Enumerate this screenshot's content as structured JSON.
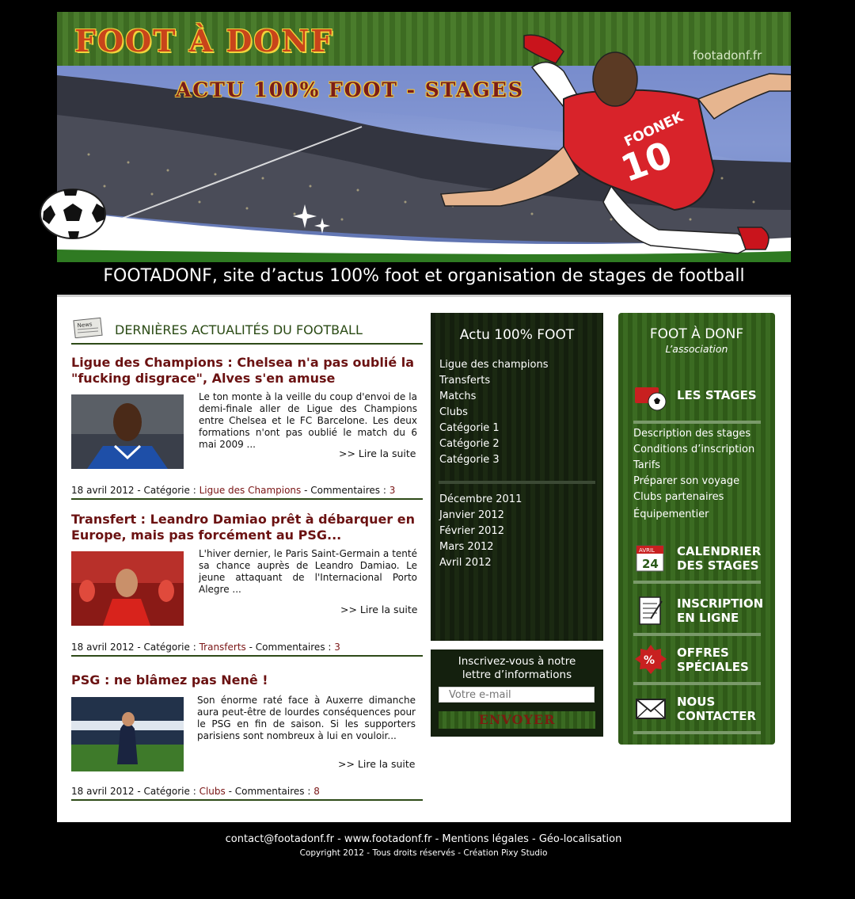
{
  "header": {
    "brand": "FOOT À DONF",
    "url": "footadonf.fr",
    "subtitle": "ACTU 100% FOOT - STAGES",
    "jersey_text": "FOONEK",
    "jersey_number": "10",
    "tagline": "FOOTADONF, site d’actus 100% foot et organisation de stages de football"
  },
  "news": {
    "section_title": "DERNIÈRES ACTUALITÉS DU FOOTBALL",
    "icon_text": "News",
    "articles": [
      {
        "title": "Ligue des Champions : Chelsea n'a pas oublié la \"fucking disgrace\", Alves s'en amuse",
        "text": "Le ton monte à la veille du coup d'envoi de la demi-finale aller de Ligue des Champions entre Chelsea et le FC Barcelone. Les deux formations n'ont pas oublié le match du 6 mai 2009 ...",
        "read_more": ">> Lire la suite",
        "date": "18 avril 2012",
        "category_label": "Catégorie :",
        "category": "Ligue des Champions",
        "comments_label": "Commentaires :",
        "comments": "3"
      },
      {
        "title": "Transfert : Leandro Damiao prêt à débarquer en Europe, mais pas forcément au PSG...",
        "text": "L'hiver dernier, le Paris Saint-Germain a tenté sa chance auprès de Leandro Damiao. Le jeune attaquant de l'Internacional Porto Alegre ...",
        "read_more": ">> Lire la suite",
        "date": "18 avril 2012",
        "category_label": "Catégorie :",
        "category": "Transferts",
        "comments_label": "Commentaires :",
        "comments": "3"
      },
      {
        "title": "PSG : ne blâmez pas Nenê !",
        "text": "Son énorme raté face à Auxerre dimanche aura peut-être de lourdes conséquences pour le PSG en fin de saison. Si les supporters parisiens sont nombreux à lui en vouloir...",
        "read_more": ">> Lire la suite",
        "date": "18 avril 2012",
        "category_label": "Catégorie :",
        "category": "Clubs",
        "comments_label": "Commentaires :",
        "comments": "8"
      }
    ]
  },
  "actu": {
    "title": "Actu 100% FOOT",
    "categories": [
      "Ligue des champions",
      "Transferts",
      "Matchs",
      "Clubs",
      "Catégorie 1",
      "Catégorie 2",
      "Catégorie 3"
    ],
    "archives": [
      "Décembre 2011",
      "Janvier 2012",
      "Février 2012",
      "Mars 2012",
      "Avril 2012"
    ]
  },
  "newsletter": {
    "label_line1": "Inscrivez-vous à notre",
    "label_line2": "lettre d’informations",
    "placeholder": "Votre e-mail",
    "button": "ENVOYER"
  },
  "association": {
    "title": "FOOT À DONF",
    "subtitle": "L’association",
    "stages_label": "LES STAGES",
    "stage_links": [
      "Description des stages",
      "Conditions d’inscription",
      "Tarifs",
      "Préparer son voyage",
      "Clubs partenaires",
      "Équipementier"
    ],
    "calendar_label_1": "CALENDRIER",
    "calendar_label_2": "DES STAGES",
    "calendar_month": "AVRIL",
    "calendar_day": "24",
    "inscription_label_1": "INSCRIPTION",
    "inscription_label_2": "EN LIGNE",
    "offers_label_1": "OFFRES",
    "offers_label_2": "SPÉCIALES",
    "offers_badge": "%",
    "contact_label_1": "NOUS",
    "contact_label_2": "CONTACTER"
  },
  "footer": {
    "links": "contact@footadonf.fr - www.footadonf.fr - Mentions légales - Géo-localisation",
    "copyright": "Copyright 2012 - Tous droits réservés - Création Pixy Studio"
  },
  "colors": {
    "background": "#000000",
    "header_green": "#3d6b22",
    "article_title": "#6b1212",
    "dark_panel": "#141f0e",
    "panel_green": "#3b6b22"
  }
}
